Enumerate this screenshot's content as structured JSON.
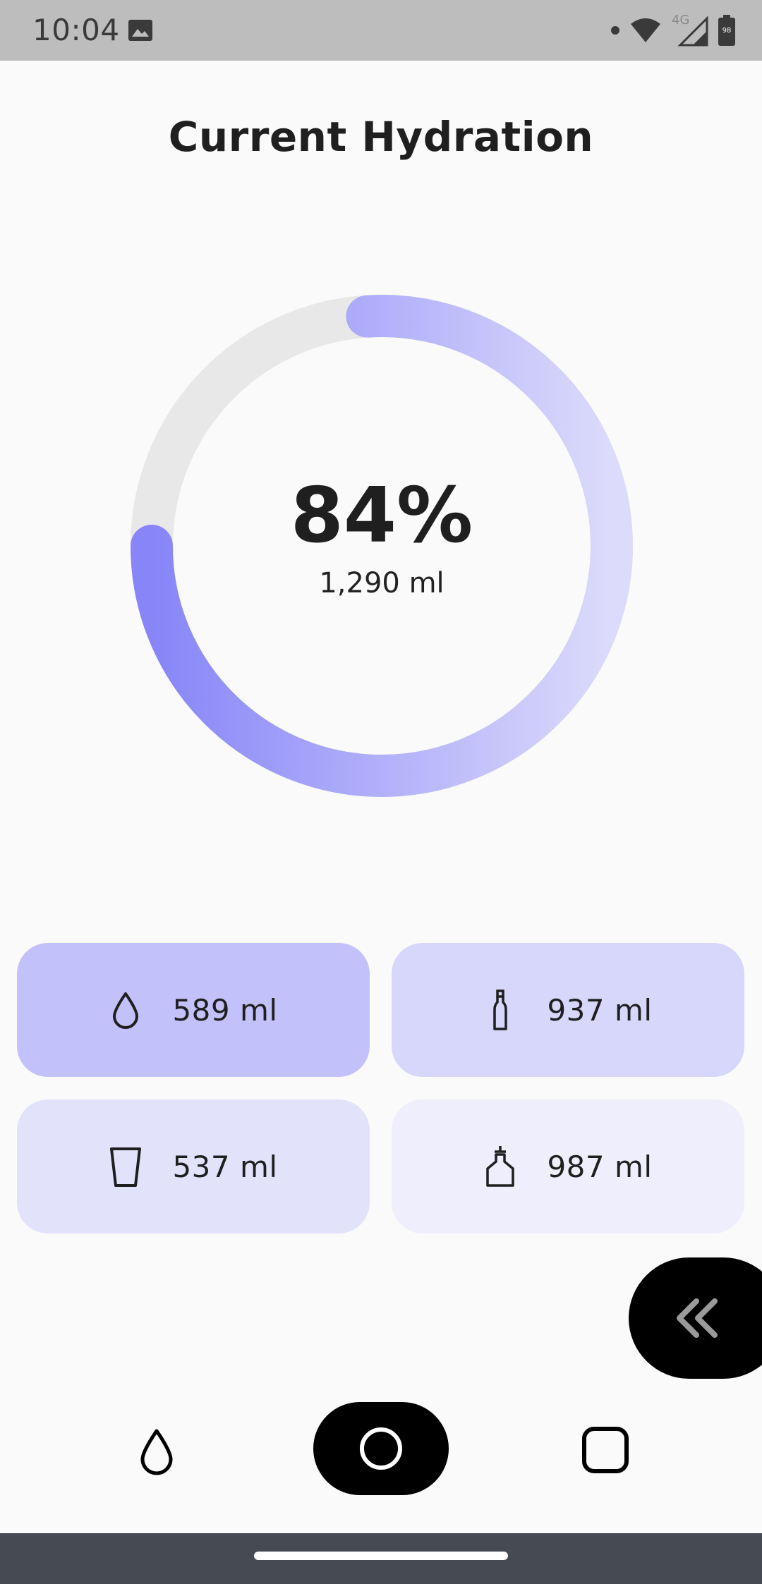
{
  "status_bar": {
    "time": "10:04",
    "network_label": "4G",
    "battery_level": "98",
    "icons": [
      "image-icon",
      "notification-dot-icon",
      "wifi-icon",
      "cell-signal-icon",
      "battery-icon"
    ]
  },
  "hydration": {
    "title": "Current Hydration",
    "percent_label": "84%",
    "volume_label": "1,290 ml",
    "progress_fraction": 0.76,
    "colors": {
      "track": "#e8e8e8",
      "gradient_start": "#8785f8",
      "gradient_end": "#dcdbfb"
    }
  },
  "drinks": [
    {
      "icon": "drop-icon",
      "label": "589 ml",
      "color": "#c3c1f9"
    },
    {
      "icon": "bottle-icon",
      "label": "937 ml",
      "color": "#d7d6fb"
    },
    {
      "icon": "glass-icon",
      "label": "537 ml",
      "color": "#e3e2fb"
    },
    {
      "icon": "flask-icon",
      "label": "987 ml",
      "color": "#efeefc"
    }
  ],
  "fab": {
    "icon": "double-chevron-left-icon"
  },
  "bottom_nav": {
    "items": [
      {
        "icon": "drop-icon",
        "active": false
      },
      {
        "icon": "circle-icon",
        "active": true
      },
      {
        "icon": "square-icon",
        "active": false
      }
    ]
  }
}
